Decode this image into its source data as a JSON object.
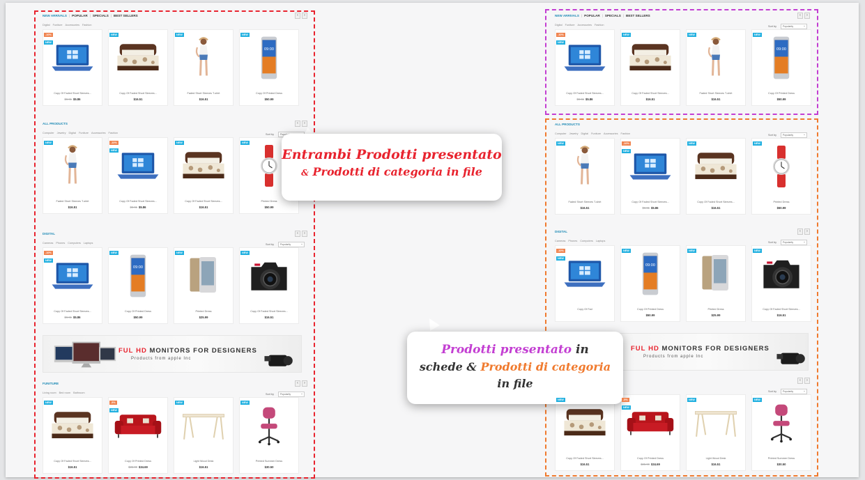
{
  "tabs": {
    "new_arrivals": "NEW ARRIVALS",
    "popular": "POPULAR",
    "specials": "SPECIALS",
    "best_sellers": "BEST SELLERS",
    "sep": "|"
  },
  "nav": {
    "prev": "‹",
    "next": "›"
  },
  "sort": {
    "label": "Sort by",
    "value": "Popularity"
  },
  "sections": {
    "featured": {
      "subtabs": [
        "Digital",
        "Funiture",
        "Accessories",
        "Fashion"
      ]
    },
    "all_products": {
      "title": "ALL PRODUCTS",
      "subtabs": [
        "Computer",
        "Jewelry",
        "Digital",
        "Funiture",
        "Accessories",
        "Fashion"
      ]
    },
    "digital": {
      "title": "DIGITAL",
      "subtabs": [
        "Cameras",
        "Phones",
        "Computers",
        "Laptops"
      ]
    },
    "funiture": {
      "title": "FUNITURE",
      "subtabs": [
        "Living room",
        "Bed room",
        "Bathroom"
      ]
    }
  },
  "badges": {
    "new": "NEW",
    "s10": "-10%",
    "s5": "-5%"
  },
  "products": {
    "laptop_featured": {
      "name": "Copy Of Faded Short Sleeves...",
      "old": "$6.61",
      "price": "$5.86"
    },
    "bed_featured": {
      "name": "Copy Of Faded Short Sleeves...",
      "price": "$16.51"
    },
    "girl_featured": {
      "name": "Faded Short Sleeves T-shirt",
      "price": "$16.51"
    },
    "phone_featured": {
      "name": "Copy Of Printed Dress",
      "price": "$50.99"
    },
    "girl_all": {
      "name": "Faded Short Sleeves T-shirt",
      "price": "$16.51"
    },
    "laptop_all": {
      "name": "Copy Of Faded Short Sleeves...",
      "old": "$6.61",
      "price": "$5.86"
    },
    "bed_all": {
      "name": "Copy Of Faded Short Sleeves...",
      "price": "$16.51"
    },
    "watch_all": {
      "name": "Printed Dress",
      "price": "$50.99"
    },
    "laptop_digital": {
      "name": "Copy Of Faded Short Sleeves...",
      "old": "$6.61",
      "price": "$5.86"
    },
    "laptop_digital_r": {
      "name": "Copy Of Fad"
    },
    "phone_digital": {
      "name": "Copy Of Printed Dress",
      "price": "$50.99"
    },
    "htc_digital": {
      "name": "Printed Dress",
      "price": "$25.99"
    },
    "camera_digital": {
      "name": "Copy Of Faded Short Sleeves...",
      "price": "$16.51"
    },
    "bed_fun": {
      "name": "Copy Of Faded Short Sleeves...",
      "price": "$16.51"
    },
    "sofa_fun": {
      "name": "Copy Of Printed Dress",
      "old": "$35.99",
      "price": "$34.69"
    },
    "desk_fun": {
      "name": "Light Wood Desk",
      "price": "$16.51"
    },
    "chair_fun": {
      "name": "Printed Summer Dress",
      "price": "$30.50"
    }
  },
  "banner": {
    "ful": "FUL",
    "hd": "HD",
    "rest": "MONITORS FOR DESIGNERS",
    "sub": "Products from apple Inc"
  },
  "callout1": {
    "l1": "Entrambi Prodotti presentato",
    "amp": "&",
    "l2": "Prodotti di categoria in file"
  },
  "callout2": {
    "p1": "Prodotti presentato",
    "p2": "in",
    "p3": "schede",
    "amp": "&",
    "p4": "Prodotti di categoria",
    "p5": "in file"
  },
  "colors": {
    "red_frame": "#e8232e",
    "magenta_frame": "#c33ed2",
    "orange_frame": "#f07a2e",
    "tab_blue": "#1e8ab5",
    "badge_new": "#21b0e0",
    "badge_sale": "#f08450"
  }
}
